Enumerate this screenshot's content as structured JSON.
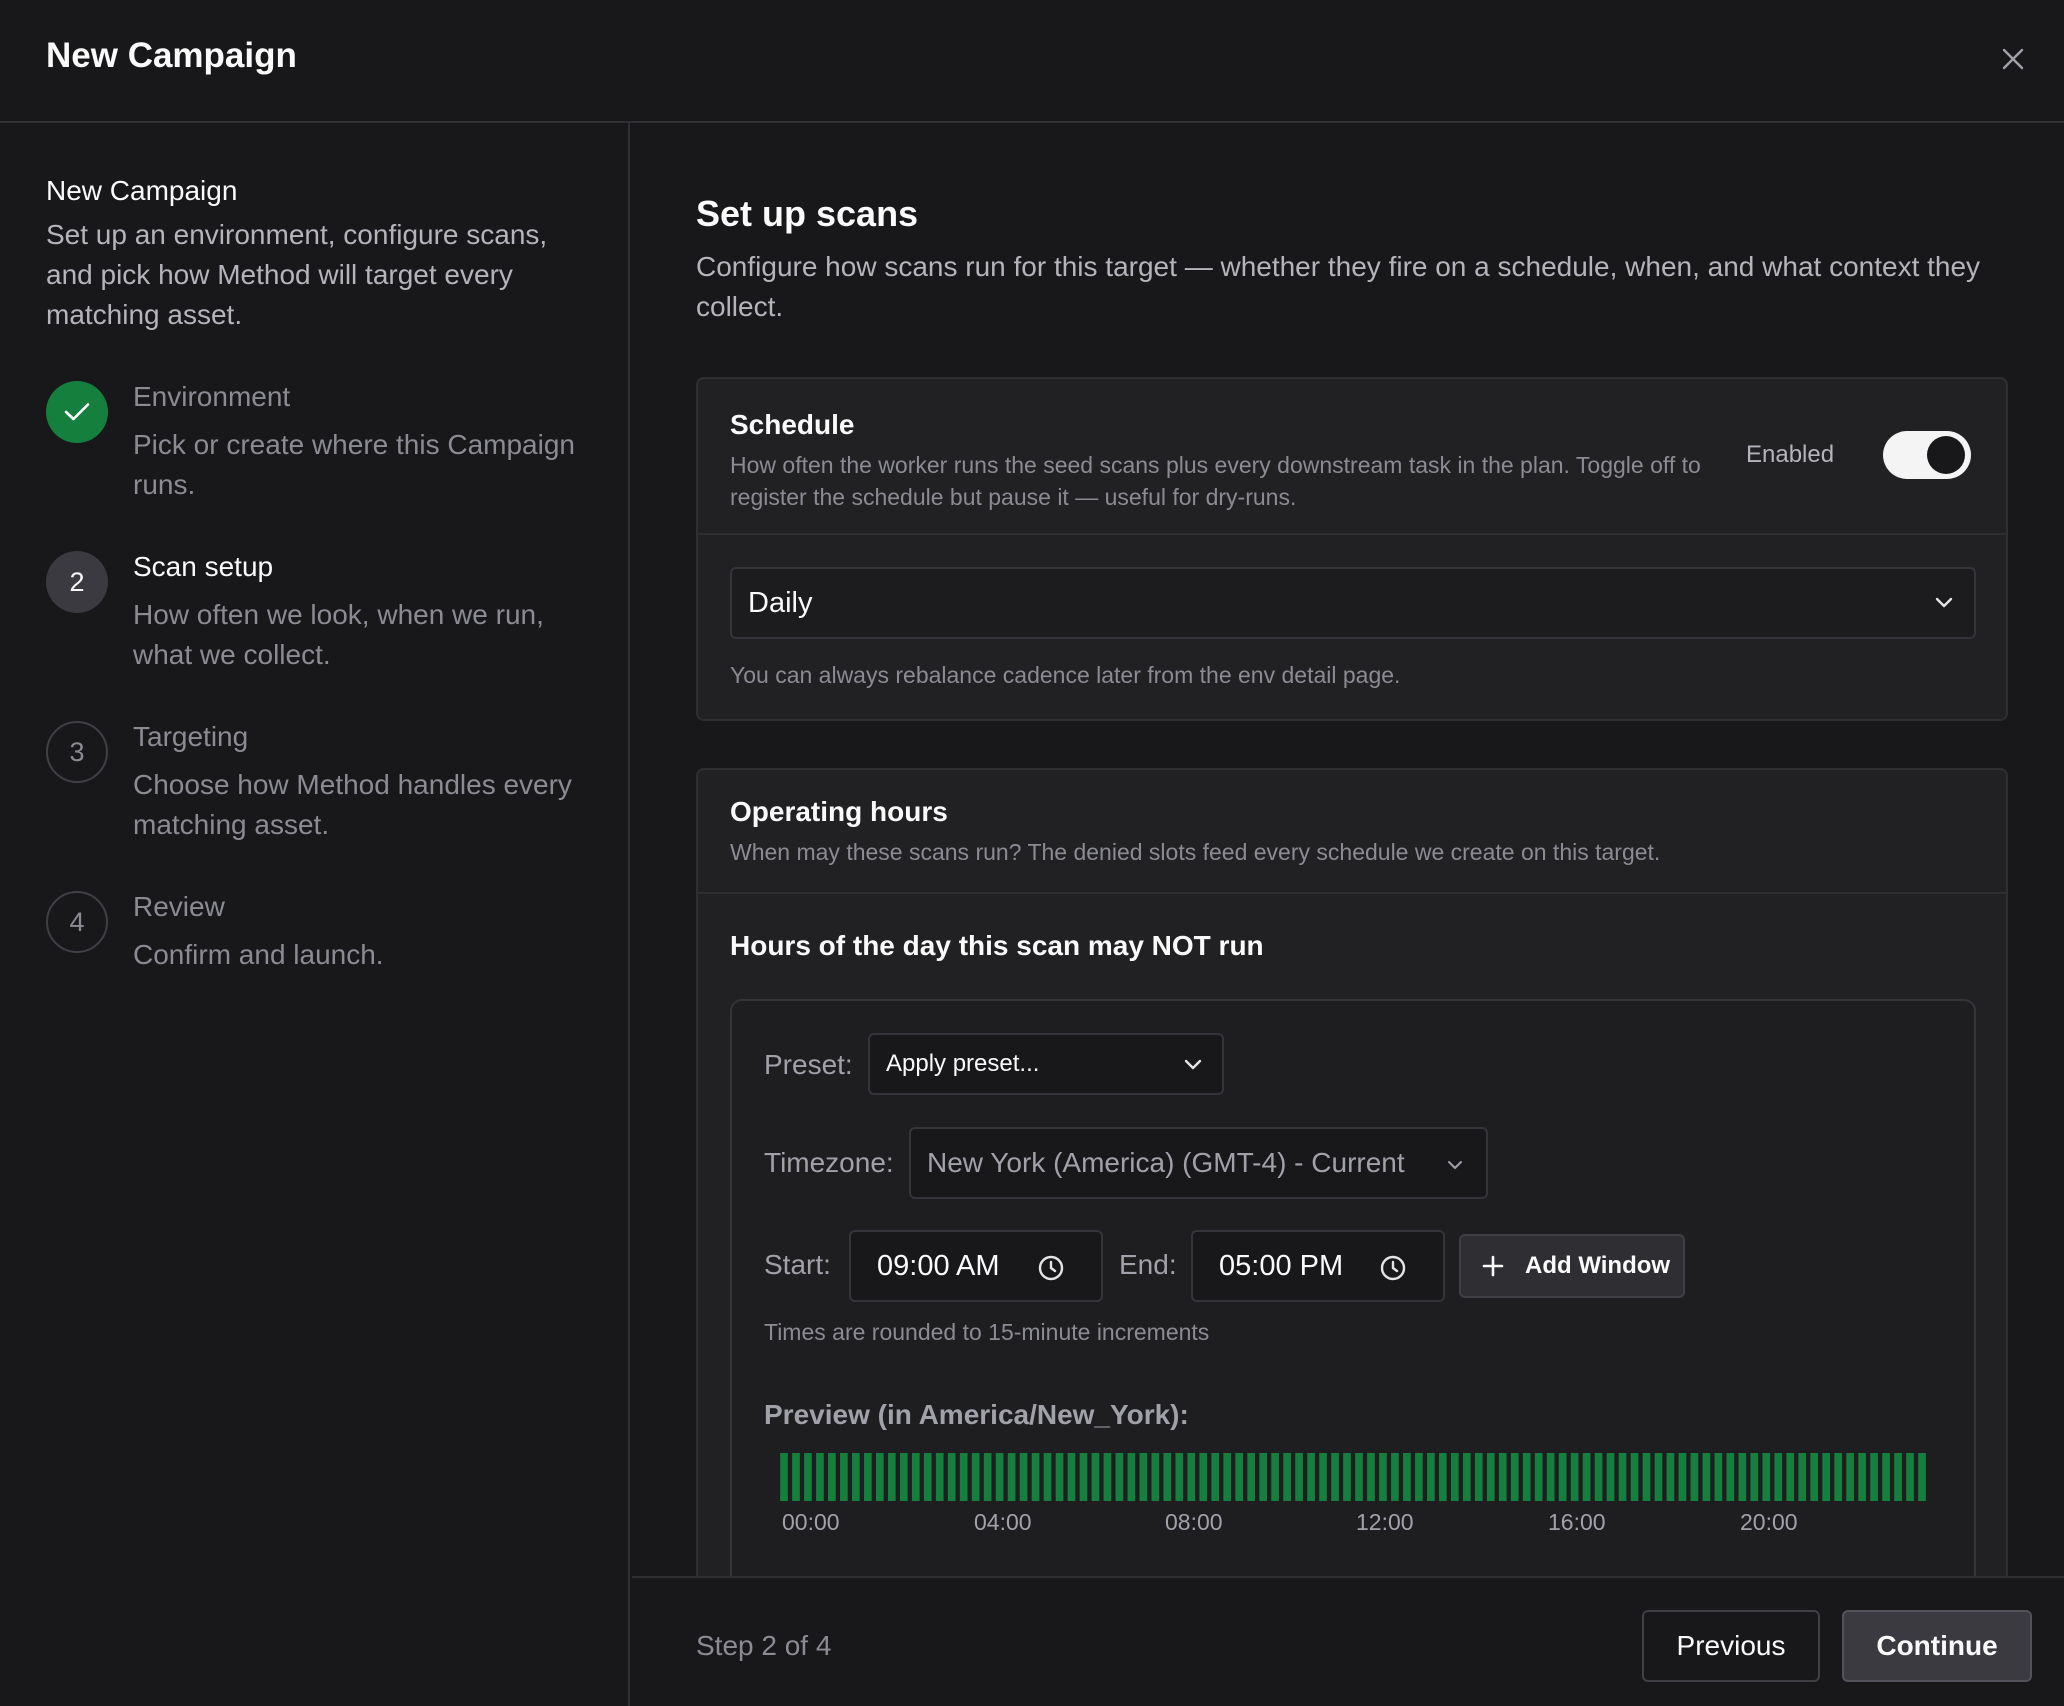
{
  "header": {
    "title": "New Campaign"
  },
  "sidebar": {
    "title": "New Campaign",
    "description": "Set up an environment, configure scans, and pick how Method will target every matching asset.",
    "steps": [
      {
        "marker": "",
        "title": "Environment",
        "desc": "Pick or create where this Campaign runs.",
        "state": "done"
      },
      {
        "marker": "2",
        "title": "Scan setup",
        "desc": "How often we look, when we run, what we collect.",
        "state": "active"
      },
      {
        "marker": "3",
        "title": "Targeting",
        "desc": "Choose how Method handles every matching asset.",
        "state": "pending"
      },
      {
        "marker": "4",
        "title": "Review",
        "desc": "Confirm and launch.",
        "state": "pending"
      }
    ]
  },
  "main": {
    "title": "Set up scans",
    "subtitle": "Configure how scans run for this target — whether they fire on a schedule, when, and what context they collect.",
    "schedule": {
      "heading": "Schedule",
      "description": "How often the worker runs the seed scans plus every downstream task in the plan. Toggle off to register the schedule but pause it — useful for dry-runs.",
      "toggle_label": "Enabled",
      "enabled": true,
      "frequency": "Daily",
      "hint": "You can always rebalance cadence later from the env detail page."
    },
    "operating_hours": {
      "heading": "Operating hours",
      "description": "When may these scans run? The denied slots feed every schedule we create on this target.",
      "section_title": "Hours of the day this scan may NOT run",
      "preset_label": "Preset:",
      "preset_value": "Apply preset...",
      "timezone_label": "Timezone:",
      "timezone_value": "New York (America) (GMT-4) - Current",
      "start_label": "Start:",
      "start_value": "09:00 AM",
      "end_label": "End:",
      "end_value": "05:00 PM",
      "add_window_label": "Add Window",
      "rounding_hint": "Times are rounded to 15-minute increments",
      "preview_title": "Preview (in America/New_York):",
      "preview_ticks": [
        "00:00",
        "04:00",
        "08:00",
        "12:00",
        "16:00",
        "20:00"
      ],
      "preview_slot_count": 96,
      "allowed_color": "#15803d"
    }
  },
  "footer": {
    "step_info": "Step 2 of 4",
    "previous_label": "Previous",
    "continue_label": "Continue"
  }
}
